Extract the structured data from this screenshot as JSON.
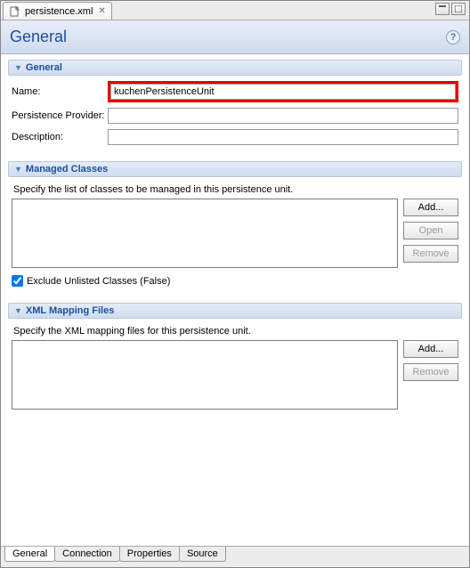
{
  "top_tab": {
    "filename": "persistence.xml"
  },
  "header": {
    "title": "General"
  },
  "section_general": {
    "title": "General",
    "name_label": "Name:",
    "name_value": "kuchenPersistenceUnit",
    "provider_label": "Persistence Provider:",
    "provider_value": "",
    "description_label": "Description:",
    "description_value": ""
  },
  "section_managed": {
    "title": "Managed Classes",
    "description": "Specify the list of classes to be managed in this persistence unit.",
    "buttons": {
      "add": "Add...",
      "open": "Open",
      "remove": "Remove"
    },
    "exclude_label": "Exclude Unlisted Classes (False)",
    "exclude_checked": true
  },
  "section_mapping": {
    "title": "XML Mapping Files",
    "description": "Specify the XML mapping files for this persistence unit.",
    "buttons": {
      "add": "Add...",
      "remove": "Remove"
    }
  },
  "bottom_tabs": {
    "general": "General",
    "connection": "Connection",
    "properties": "Properties",
    "source": "Source"
  }
}
